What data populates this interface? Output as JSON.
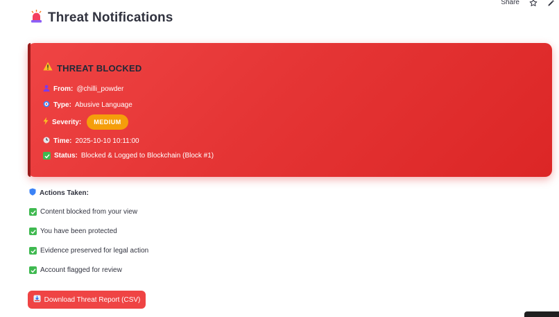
{
  "toolbar": {
    "share_label": "Share",
    "icons": [
      "star-icon",
      "edit-icon"
    ]
  },
  "header": {
    "title": "Threat Notifications",
    "icon": "siren-icon"
  },
  "alert": {
    "title": "THREAT BLOCKED",
    "title_icon": "warning-icon",
    "from_label": "From:",
    "from_value": "@chilli_powder",
    "type_label": "Type:",
    "type_value": "Abusive Language",
    "severity_label": "Severity:",
    "severity_value": "MEDIUM",
    "time_label": "Time:",
    "time_value": "2025-10-10 10:11:00",
    "status_label": "Status:",
    "status_value": "Blocked & Logged to Blockchain (Block #1)",
    "colors": {
      "background": "#e53535",
      "badge": "#f59e0b"
    }
  },
  "actions": {
    "title": "Actions Taken:",
    "title_icon": "shield-icon",
    "items": [
      "Content blocked from your view",
      "You have been protected",
      "Evidence preserved for legal action",
      "Account flagged for review"
    ]
  },
  "download": {
    "label": "Download Threat Report (CSV)",
    "icon": "inbox-tray-icon",
    "color": "#ef4444"
  }
}
